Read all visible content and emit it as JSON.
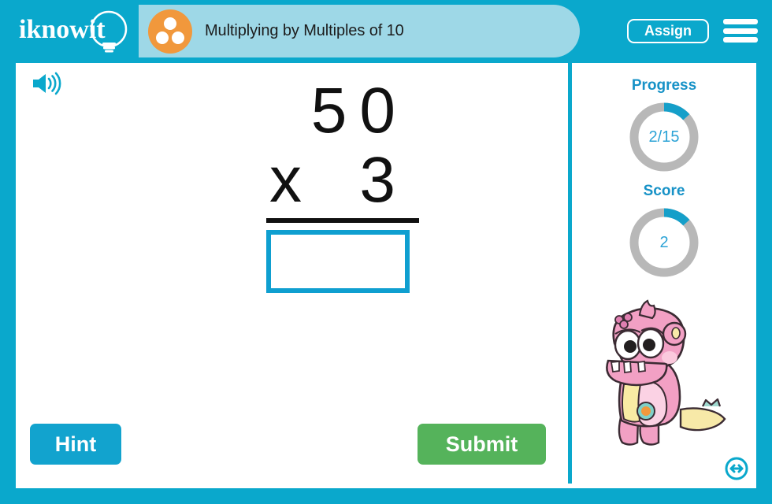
{
  "header": {
    "logo_text": "iknowit",
    "logo_icon": "lightbulb-icon",
    "badge_icon": "three-dots-circle-icon",
    "lesson_title": "Multiplying by Multiples of 10",
    "assign_label": "Assign",
    "menu_icon": "hamburger-menu-icon"
  },
  "toolbar": {
    "speaker_icon": "speaker-sound-icon"
  },
  "problem": {
    "multiplicand": "50",
    "operator": "x",
    "multiplier": "3",
    "answer_value": "",
    "answer_placeholder": ""
  },
  "side": {
    "progress_label": "Progress",
    "progress_value": "2/15",
    "progress_percent": 13.3,
    "score_label": "Score",
    "score_value": "2",
    "score_percent": 13.3,
    "mascot_icon": "pink-monster-mascot",
    "resize_icon": "resize-horizontal-icon"
  },
  "actions": {
    "hint_label": "Hint",
    "submit_label": "Submit"
  },
  "colors": {
    "brand_blue": "#0aa8cc",
    "pill_blue": "#9ed8e7",
    "accent_orange": "#f1983c",
    "submit_green": "#55b35b",
    "ring_track": "#b8b8b8",
    "ring_fill": "#159fc9",
    "mascot_pink": "#f2a0c4"
  }
}
